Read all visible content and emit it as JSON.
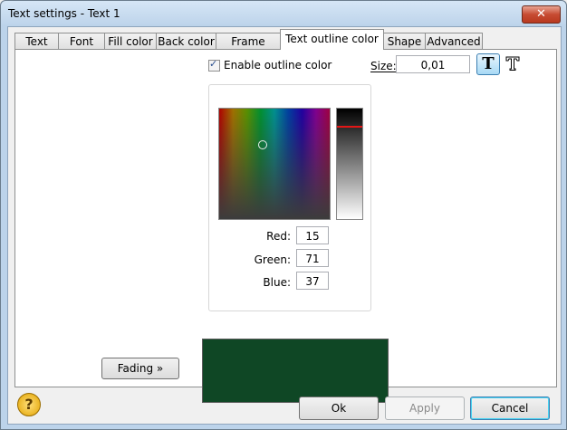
{
  "window": {
    "title": "Text settings - Text 1",
    "close_label": "✕"
  },
  "tabs": [
    {
      "label": "Text"
    },
    {
      "label": "Font"
    },
    {
      "label": "Fill color"
    },
    {
      "label": "Back color"
    },
    {
      "label": "Frame color"
    },
    {
      "label": "Text outline color",
      "active": true
    },
    {
      "label": "Shape"
    },
    {
      "label": "Advanced"
    }
  ],
  "outline": {
    "enable_label": "Enable outline color",
    "enabled": true,
    "size_label": "Size:",
    "size_value": "0,01"
  },
  "color": {
    "red_label": "Red:",
    "red": "15",
    "green_label": "Green:",
    "green": "71",
    "blue_label": "Blue:",
    "blue": "37",
    "preview_hex": "#0f4725"
  },
  "buttons": {
    "fading": "Fading »",
    "ok": "Ok",
    "apply": "Apply",
    "cancel": "Cancel"
  },
  "icons": {
    "help": "help-icon",
    "text_solid": "text-solid-icon",
    "text_outline": "text-outline-icon"
  }
}
